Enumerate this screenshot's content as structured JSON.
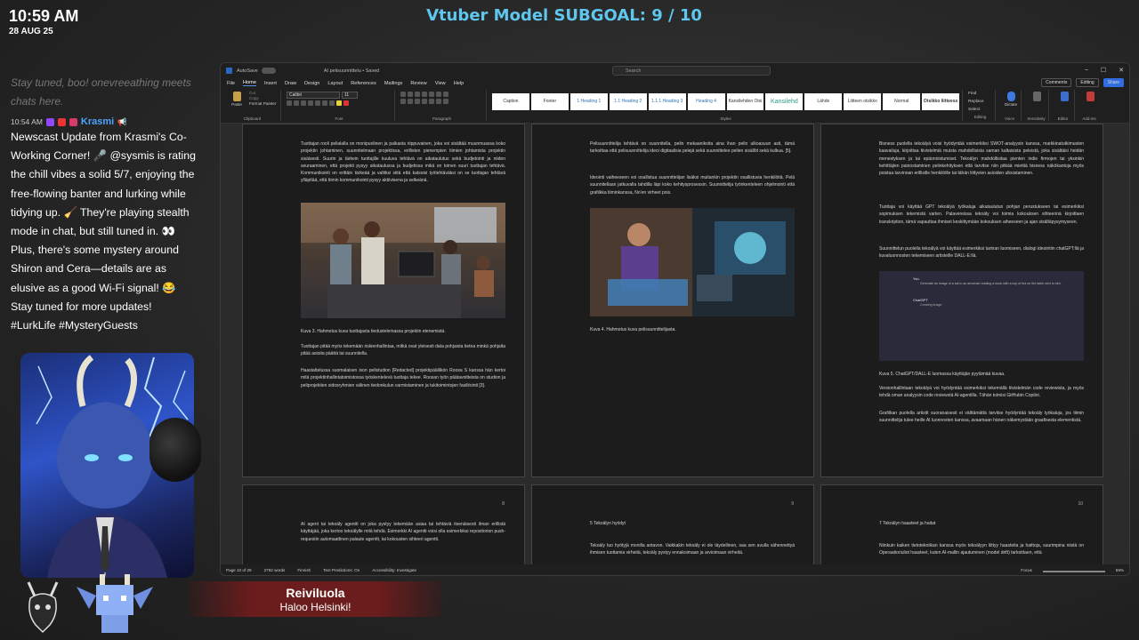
{
  "overlay": {
    "time": "10:59 AM",
    "date": "28 AUG 25",
    "subgoal": "Vtuber Model SUBGOAL: 9 / 10",
    "chat": {
      "faded_text": "Stay tuned, boo! onevreeathing meets chats here.",
      "timestamp": "10:54 AM",
      "username": "Krasmi",
      "message": "Newscast Update from Krasmi's Co-Working Corner! 🎤 @sysmis is rating the chill vibes a solid 5/7, enjoying the free-flowing banter and lurking while tidying up. 🧹 They're playing stealth mode in chat, but still tuned in. 👀 Plus, there's some mystery around Shiron and Cera—details are as elusive as a good Wi-Fi signal! 😂 Stay tuned for more updates! #LurkLife #MysteryGuests"
    },
    "nameplate": {
      "name": "Reiviluola",
      "greeting": "Haloo Helsinki!"
    }
  },
  "word": {
    "autosave": "AutoSave",
    "doc_title": "AI pelisuunnittelu • Saved",
    "search_placeholder": "Search",
    "menu": [
      "File",
      "Home",
      "Insert",
      "Draw",
      "Design",
      "Layout",
      "References",
      "Mailings",
      "Review",
      "View",
      "Help"
    ],
    "comments_label": "Comments",
    "editing_label": "Editing",
    "share_label": "Share",
    "ribbon": {
      "paste": "Paste",
      "cut": "Cut",
      "copy": "Copy",
      "format_painter": "Format Painter",
      "clipboard": "Clipboard",
      "font_name": "Calibri",
      "font_size": "11",
      "font": "Font",
      "paragraph": "Paragraph",
      "styles_label": "Styles",
      "styles": [
        "Caption",
        "Footer",
        "1 Heading 1",
        "1.1 Heading 2",
        "1.1.1 Heading 3",
        "Heading 4",
        "Kansilehden Otsi",
        "Kansilehd",
        "Lähde",
        "Liitteen otsikko",
        "Normal",
        "Otsikko liitteess"
      ],
      "find": "Find",
      "replace": "Replace",
      "select": "Select",
      "editing": "Editing",
      "dictate": "Dictate",
      "voice": "Voice",
      "sensitivity": "Sensitivity",
      "editor": "Editor",
      "addins": "Add-ins"
    },
    "pages": {
      "p1": {
        "para1": "Tuottajan rooli pelialalla on monipuolinen ja paikasta riippuvainen, joka voi sisältää muunmuassa koko projektin johtaminen, suunnitelmaan projektissa, erillisten pienempien tiimien johtamista projektin sisäisesti. Suurin ja tärkein tuottajille kuuluva tehtävä on aikataulutus sekä budjetointi ja niiden seuraaminen, että projekti pysyy aikataulussa ja budjetissa mikä on toinen suuri tuottajan tehtävä. Kommunikointi on erittäin tärkeää ja valtiksi siitä että katsoisi työtehtäväksi on se tuottajan tehtävä ylläpitää, että tiimin kommunikointi pysyy aktiivisena ja selkeänä.",
        "caption": "Kuva 3. Hahmotus kuva tuottajasta tiedustelemassa projektin etenemistä.",
        "para2": "Tuottajan pitää myös tekemään riskienhallintaa, mitkä ovat yleisesti data pohjaista tietoa minkä pohjalta pitää asioita päättä tai suunnitella.",
        "para3": "Haastattelussa suomalaisen ison pelistudion [Redacted] projektipäällikön Roosa S kanssa hän kertoi mitä projektinhallintatoimistossa työskentelevä tuottaja tekee. Roosan työn päätavoitteista on studion ja peliprojektien sidosryhmien välinen tiedonkulun varmistaminen ja tukitoimintojen fasilitointi [3]."
      },
      "p2": {
        "para1": "Pelisuunnittelija tehtävä on suunnitella, pelin mekaanikoita aina ihan pelin ulkoasuun asti, tämä tarkoittaa että pelisuunnittelija ideoi digitaalisia pelejä sekä suunnittelee pelien sisällöt sekä kulkua. [5].",
        "para2": "Ideointi vaiheeseen voi osallistua suunnittelijan lisäksi muitankin projektin osallistuvia henkilöitä. Pelä suunnitellaan jatkuvalla tahdilla läpi koko kehitysprosessin. Suunnittelija työnkenteleen ohjelmointi että grafiikka tiiminkanssa, No'en virheet pois.",
        "caption": "Kuva 4. Hahmotus kuva pelisuunnittelijasta."
      },
      "p3": {
        "para1": "Bisness puolella tekoälyä voisi hyödyntää esimerkiksi SWOT-analyysin kanssa, markkinatutkimusten kaavailuja, kirjoittaa tiivistelmiä muista mahdollisista saman kaltaisista peleistä, joka sisältäisi heidän menestyksen ja tai epäonnistumiset. Tekoälyn mahdollisitaa pienten indie firmojen tai yksinkin kehittäjien painostaminen pelinkehityksen että tarvitse niin pitkää miettiä bisness näkökantoja myös poistaa tarvinnan erillisille henkilöille tai tähän liittyvien asioiden ulkoistaminen.",
        "para2": "Tuottaja voi käyttää GPT tekoälyä työkaluja aikataulutun pohjan perustukseen tai esimerkiksi sopimuksen tekemistä varten. Palavereissa tekoäly voi toimia kokouksen sihteerinä kirjoittaen transkription, tämä vapauttaa ihmiset keskittymään kokouksen aiheeseen ja ajan sisältäpysymyseen.",
        "para3": "Suunnittelun puolella tekoälyä voi käyttää esimerkiksi tarinan luomiseen, dialogi ideointiin chatGPT:llä ja kuvaluonnosten tekemiseen artisteille DALL-E:llä.",
        "chat_you": "You",
        "chat_prompt": "Generate an image of a cat in an armchair reading a book with a cup of tea on the table next to him.",
        "chat_gpt": "ChatGPT",
        "chat_status": "Creating image",
        "caption": "Kuva 5. ChatGPT/DALL-E luomassa käyttäjän pyytämää kuvaa.",
        "para4": "Versionhallintaan tekoälyä voi hyödyntää esimerkiksi tekemällä tiivistelmän code reviewista, ja myös tehdä oman analyysin code reviewstä AI-agentilla. Tähän toimisi GitHubin Copilot.",
        "para5": "Grafiikan puolella artistit suoranaisesti ei välttämättä tarvitse hyödyntää tekoäly työkaluja, jos tiimin suunnittelija tulee heille AI luonnosten kanssa, avaamaan hänen näkemystään graafisesta elementistä."
      },
      "p4": {
        "num": "8",
        "para": "AI agent tai tekoäly agentti on joka pystyy tekemään asiaa tai tehtäviä itsenäisesti ilman erillistä käyttäjää, joka kertoo tekoälylle mitä tehdä. Esimerkki AI agentti voisi olla esimerkiksi repositorion push-requestin automaattinen palaute agentti, tai kokousten sihteeri agentti."
      },
      "p5": {
        "num": "9",
        "heading": "5      Tekoälyn hyödyt",
        "para": "Tekoäly tuo hyötyjä monilla antavon. Vaikkakin tekoäly ei ole täydellinen, saa sen avulla vähennettyä ihmisen tuottamia virheitä, tekoäly pystyy ennakoimaan ja arvioimaan virheitä."
      },
      "p6": {
        "num": "10",
        "heading": "7      Tekoälyn haasteet ja haitat",
        "para": "Niinkuin kaiken tietotekniikan kanssa myös tekoälyyn liittyy haasteita ja haittoja, suurimpina niistä on Operaatioriuliot haasteet, kuten AI-mallin ajautuminen (model drift) tarkoittaen, että"
      }
    },
    "status": {
      "page": "Page 10 of 29",
      "words": "2792 words",
      "lang": "Finnish",
      "predictions": "Text Predictions: On",
      "accessibility": "Accessibility: Investigate",
      "focus": "Focus",
      "zoom": "59%"
    }
  },
  "colors": {
    "subgoal": "#5fc6ef",
    "username": "#4da3ff",
    "accent": "#2f6de0"
  }
}
